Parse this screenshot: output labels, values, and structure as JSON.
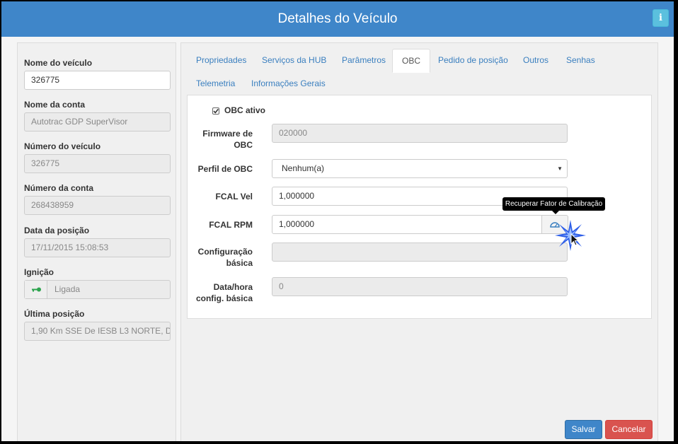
{
  "header": {
    "title": "Detalhes do Veículo",
    "info_label": "i"
  },
  "left": {
    "vehicle_name_label": "Nome do veículo",
    "vehicle_name_value": "326775",
    "account_name_label": "Nome da conta",
    "account_name_value": "Autotrac GDP SuperVisor",
    "vehicle_number_label": "Número do veículo",
    "vehicle_number_value": "326775",
    "account_number_label": "Número da conta",
    "account_number_value": "268438959",
    "position_date_label": "Data da posição",
    "position_date_value": "17/11/2015 15:08:53",
    "ignition_label": "Ignição",
    "ignition_value": "Ligada",
    "last_position_label": "Última posição",
    "last_position_value": "1,90 Km SSE De IESB L3 NORTE, D"
  },
  "tabs": [
    {
      "label": "Propriedades"
    },
    {
      "label": "Serviços da HUB"
    },
    {
      "label": "Parâmetros"
    },
    {
      "label": "OBC"
    },
    {
      "label": "Pedido de posição"
    },
    {
      "label": "Outros"
    },
    {
      "label": "Senhas"
    },
    {
      "label": "Telemetria"
    },
    {
      "label": "Informações Gerais"
    }
  ],
  "obc": {
    "active_label": "OBC ativo",
    "active_checked": true,
    "firmware_label_1": "Firmware de",
    "firmware_label_2": "OBC",
    "firmware_value": "020000",
    "profile_label": "Perfil de OBC",
    "profile_value": "Nenhum(a)",
    "fcal_vel_label": "FCAL Vel",
    "fcal_vel_value": "1,000000",
    "fcal_rpm_label": "FCAL RPM",
    "fcal_rpm_value": "1,000000",
    "basic_config_label_1": "Configuração",
    "basic_config_label_2": "básica",
    "basic_config_value": "",
    "datetime_label_1": "Data/hora",
    "datetime_label_2": "config. básica",
    "datetime_value": "0",
    "tooltip": "Recuperar Fator de Calibração"
  },
  "footer": {
    "save_label": "Salvar",
    "cancel_label": "Cancelar"
  },
  "colors": {
    "header": "#3f86c9",
    "link": "#3a7fbf",
    "save": "#3f86c9",
    "cancel": "#d9534f",
    "info": "#5bc0de"
  }
}
